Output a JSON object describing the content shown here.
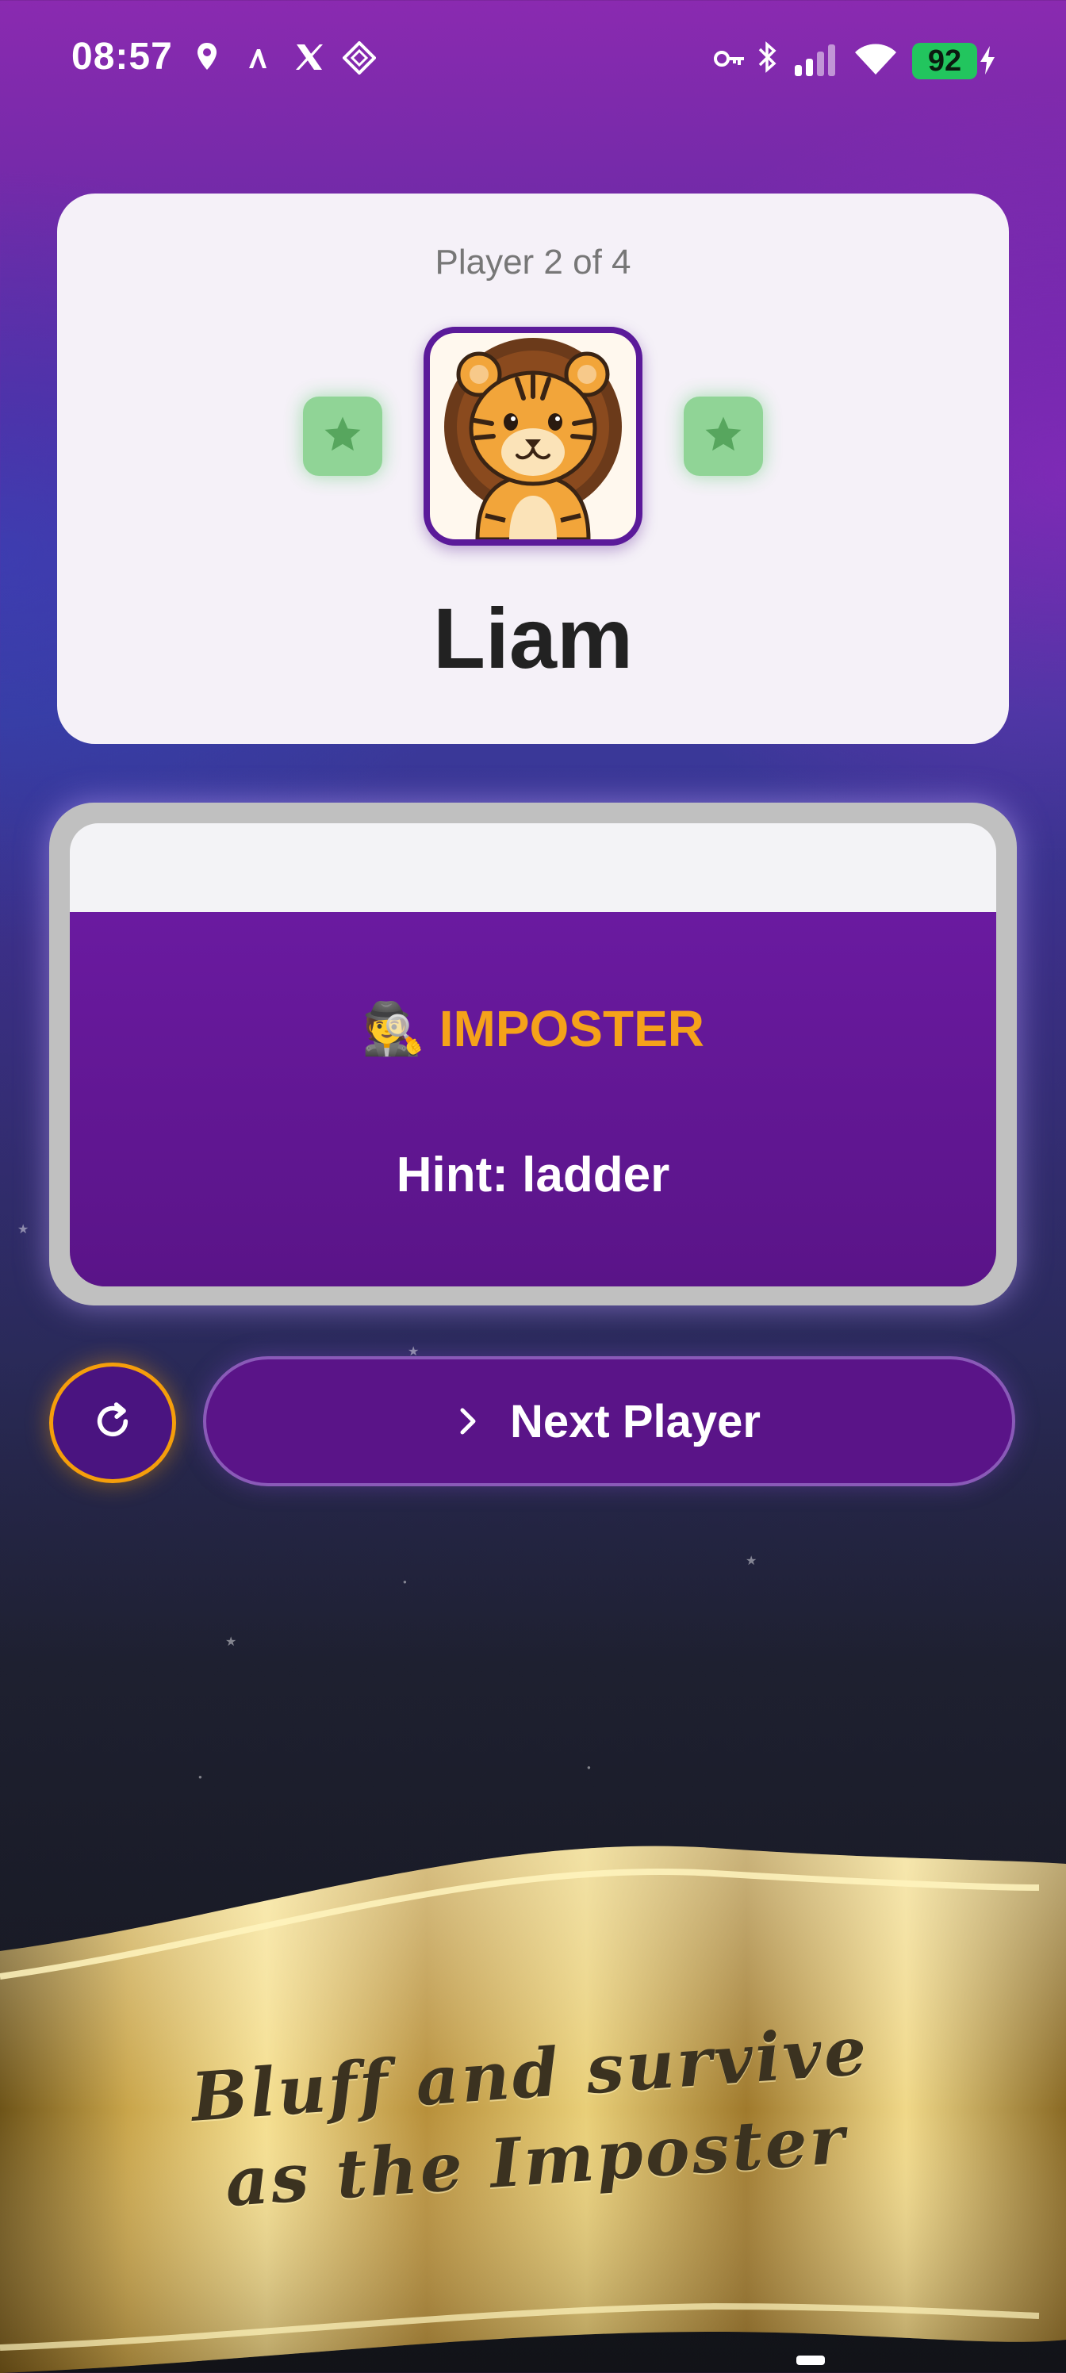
{
  "status_bar": {
    "time": "08:57",
    "battery": "92",
    "icons": [
      "location-icon",
      "app-a-icon",
      "x-icon",
      "app-diamond-icon",
      "vpn-key-icon",
      "bluetooth-icon",
      "signal-icon",
      "wifi-icon",
      "charging-icon"
    ]
  },
  "player": {
    "count_label": "Player 2 of 4",
    "name": "Liam",
    "avatar": "lion-avatar"
  },
  "role": {
    "emoji": "🕵",
    "title": "IMPOSTER",
    "hint": "Hint: ladder"
  },
  "actions": {
    "next_label": "Next Player"
  },
  "banner": {
    "line1": "Bluff and survive",
    "line2": "as the Imposter"
  },
  "colors": {
    "accent_orange": "#f5a21a",
    "card_purple": "#5a1488",
    "star_green": "#43a047"
  }
}
